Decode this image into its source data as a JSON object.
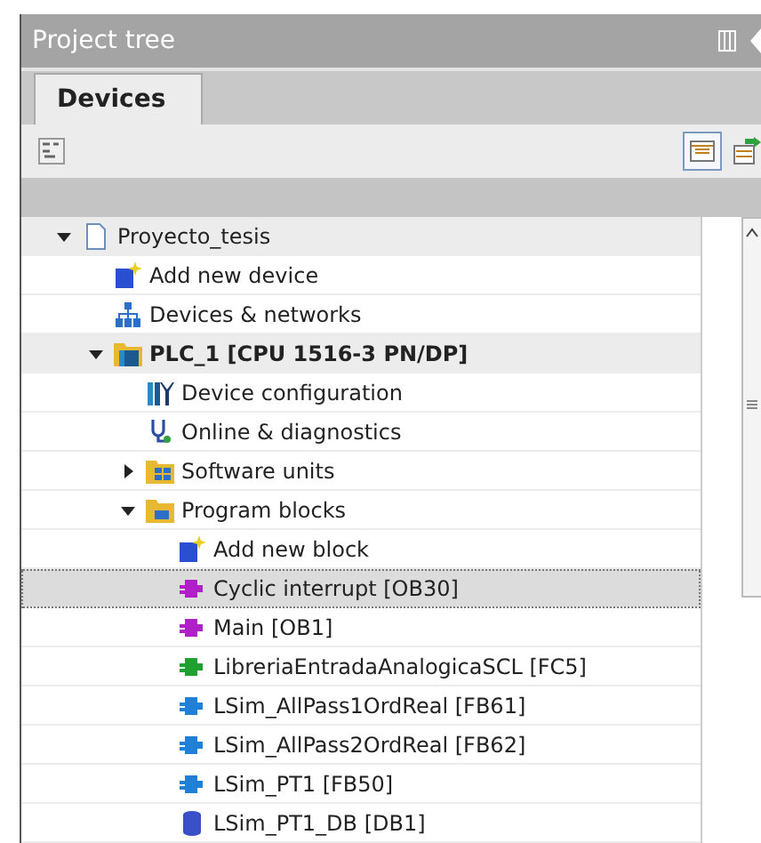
{
  "panel": {
    "title": "Project tree"
  },
  "tabs": [
    {
      "label": "Devices",
      "selected": true
    }
  ],
  "tree": [
    {
      "label": "Proyecto_tesis",
      "kind": "project",
      "expanded": true,
      "children": [
        {
          "label": "Add new device",
          "kind": "add"
        },
        {
          "label": "Devices & networks",
          "kind": "network"
        },
        {
          "label": "PLC_1 [CPU 1516-3 PN/DP]",
          "kind": "plc",
          "expanded": true,
          "children": [
            {
              "label": "Device configuration",
              "kind": "config"
            },
            {
              "label": "Online & diagnostics",
              "kind": "diagnostics"
            },
            {
              "label": "Software units",
              "kind": "units",
              "expanded": false
            },
            {
              "label": "Program blocks",
              "kind": "folder",
              "expanded": true,
              "children": [
                {
                  "label": "Add new block",
                  "kind": "add",
                  "selected": false
                },
                {
                  "label": "Cyclic interrupt [OB30]",
                  "kind": "block",
                  "color": "#b020c8",
                  "selected": true
                },
                {
                  "label": "Main [OB1]",
                  "kind": "block",
                  "color": "#b020c8",
                  "selected": false
                },
                {
                  "label": "LibreriaEntradaAnalogicaSCL [FC5]",
                  "kind": "block",
                  "color": "#20a030",
                  "selected": false
                },
                {
                  "label": "LSim_AllPass1OrdReal [FB61]",
                  "kind": "block",
                  "color": "#2080d8",
                  "selected": false
                },
                {
                  "label": "LSim_AllPass2OrdReal [FB62]",
                  "kind": "block",
                  "color": "#2080d8",
                  "selected": false
                },
                {
                  "label": "LSim_PT1 [FB50]",
                  "kind": "block",
                  "color": "#2080d8",
                  "selected": false
                },
                {
                  "label": "LSim_PT1_DB [DB1]",
                  "kind": "db",
                  "selected": false
                }
              ]
            }
          ]
        }
      ]
    }
  ]
}
